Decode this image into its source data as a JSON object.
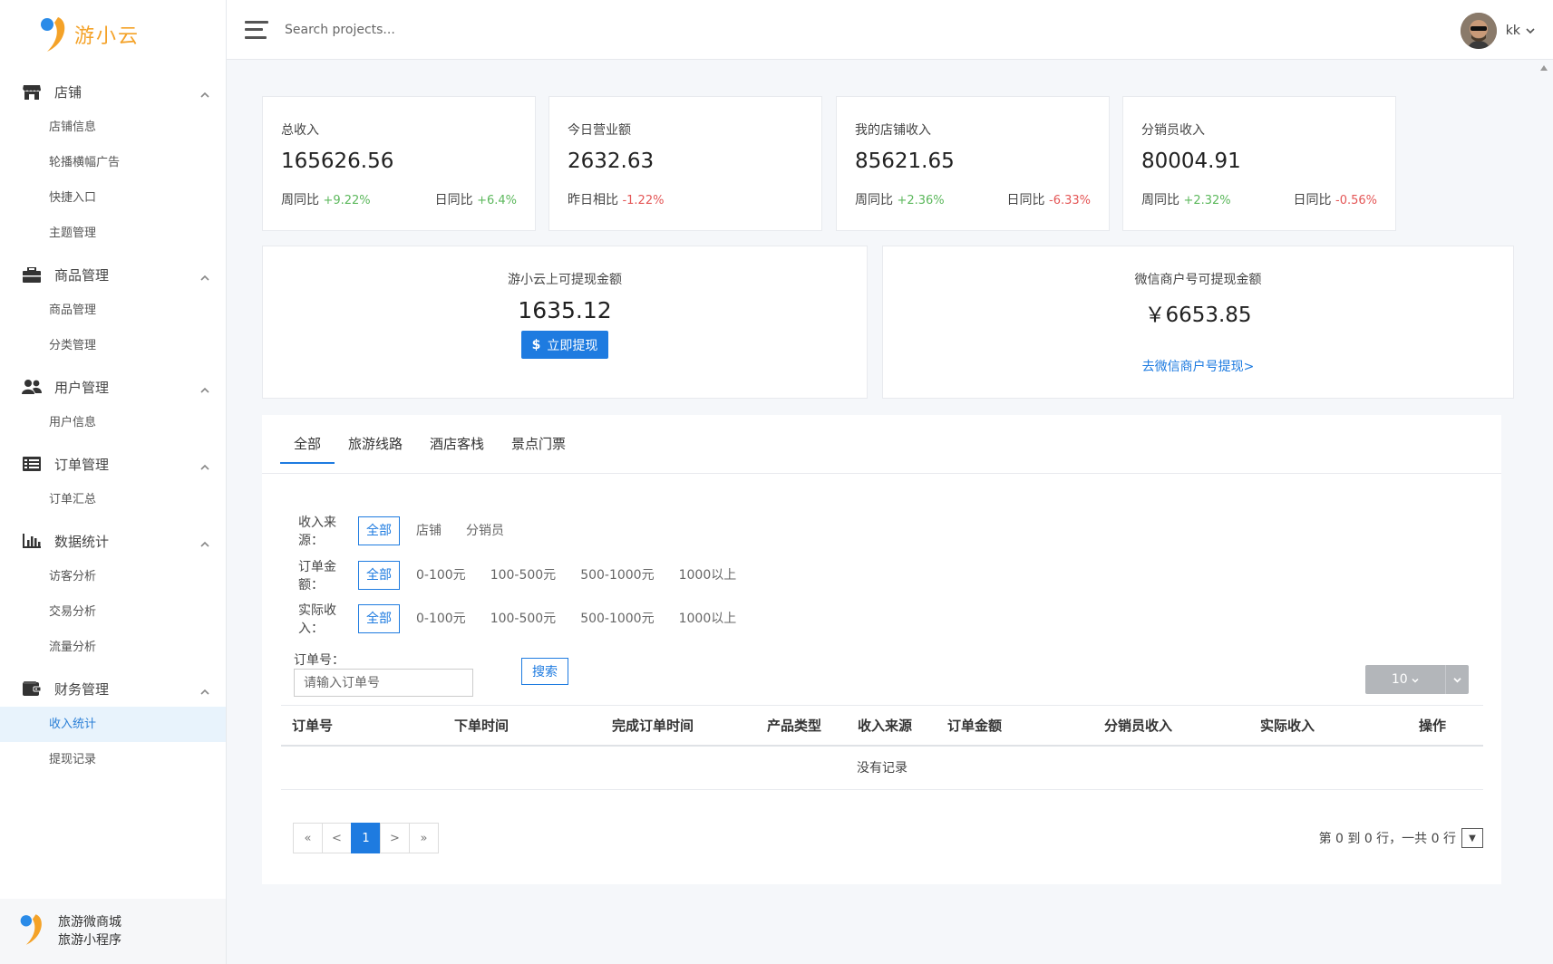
{
  "brand": {
    "logo_text": "游小云"
  },
  "header": {
    "search_placeholder": "Search projects...",
    "username": "kk"
  },
  "sidebar": {
    "groups": [
      {
        "label": "店铺",
        "icon": "store-icon",
        "items": [
          "店铺信息",
          "轮播横幅广告",
          "快捷入口",
          "主题管理"
        ]
      },
      {
        "label": "商品管理",
        "icon": "briefcase-icon",
        "items": [
          "商品管理",
          "分类管理"
        ]
      },
      {
        "label": "用户管理",
        "icon": "users-icon",
        "items": [
          "用户信息"
        ]
      },
      {
        "label": "订单管理",
        "icon": "list-icon",
        "items": [
          "订单汇总"
        ]
      },
      {
        "label": "数据统计",
        "icon": "bar-chart-icon",
        "items": [
          "访客分析",
          "交易分析",
          "流量分析"
        ]
      },
      {
        "label": "财务管理",
        "icon": "wallet-icon",
        "items": [
          "收入统计",
          "提现记录"
        ]
      }
    ],
    "active_item": "收入统计",
    "footer_line1": "旅游微商城",
    "footer_line2": "旅游小程序"
  },
  "stats": [
    {
      "title": "总收入",
      "value": "165626.56",
      "left_label": "周同比",
      "left_delta": "+9.22%",
      "right_label": "日同比",
      "right_delta": "+6.4%"
    },
    {
      "title": "今日营业额",
      "value": "2632.63",
      "left_label": "昨日相比",
      "left_delta": "-1.22%",
      "right_label": "",
      "right_delta": ""
    },
    {
      "title": "我的店铺收入",
      "value": "85621.65",
      "left_label": "周同比",
      "left_delta": "+2.36%",
      "right_label": "日同比",
      "right_delta": "-6.33%"
    },
    {
      "title": "分销员收入",
      "value": "80004.91",
      "left_label": "周同比",
      "left_delta": "+2.32%",
      "right_label": "日同比",
      "right_delta": "-0.56%"
    }
  ],
  "withdraw": {
    "platform_title": "游小云上可提现金额",
    "platform_value": "1635.12",
    "platform_button": "立即提现",
    "wechat_title": "微信商户号可提现金额",
    "wechat_value": "￥6653.85",
    "wechat_link": "去微信商户号提现>"
  },
  "tabs": [
    "全部",
    "旅游线路",
    "酒店客栈",
    "景点门票"
  ],
  "filters": [
    {
      "label": "收入来源：",
      "options": [
        "全部",
        "店铺",
        "分销员"
      ]
    },
    {
      "label": "订单金额：",
      "options": [
        "全部",
        "0-100元",
        "100-500元",
        "500-1000元",
        "1000以上"
      ]
    },
    {
      "label": "实际收入：",
      "options": [
        "全部",
        "0-100元",
        "100-500元",
        "500-1000元",
        "1000以上"
      ]
    }
  ],
  "search": {
    "label": "订单号：",
    "placeholder": "请输入订单号",
    "button": "搜索"
  },
  "page_size": "10",
  "table": {
    "columns": [
      "订单号",
      "下单时间",
      "完成订单时间",
      "产品类型",
      "收入来源",
      "订单金额",
      "分销员收入",
      "实际收入",
      "操作"
    ],
    "empty_text": "没有记录"
  },
  "pagination": {
    "first": "«",
    "prev": "<",
    "current": "1",
    "next": ">",
    "last": "»",
    "info": "第 0 到 0 行，一共 0 行"
  },
  "colors": {
    "accent": "#1e7be0",
    "up": "#5cb85c",
    "down": "#e45656",
    "brand": "#f4a228"
  }
}
